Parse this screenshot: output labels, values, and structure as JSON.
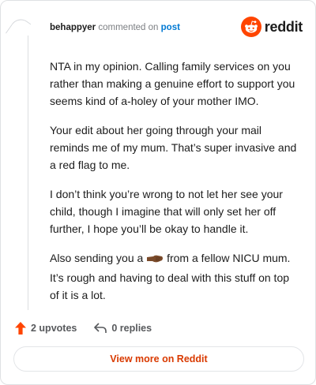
{
  "header": {
    "username": "behappyer",
    "action": "commented on",
    "target": "post"
  },
  "brand": {
    "wordmark": "reddit",
    "icon": "reddit-snoo-icon",
    "color": "#ff4500"
  },
  "comment": {
    "paragraphs": [
      "NTA in my opinion. Calling family services on you rather than making a genuine effort to support you seems kind of a-holey of your mother IMO.",
      "Your edit about her going through your mail reminds me of my mum. That’s super invasive and a red flag to me.",
      "I don’t think you’re wrong to not let her see your child, though I imagine that will only set her off further, I hope you’ll be okay to handle it."
    ],
    "last_paragraph": {
      "before_emoji": "Also sending you a ",
      "emoji": "fist-bump-icon",
      "after_emoji": " from a fellow NICU mum. It’s rough and having to deal with this stuff on top of it is a lot."
    }
  },
  "footer": {
    "upvotes": "2 upvotes",
    "replies": "0 replies",
    "upvote_color": "#ff4500"
  },
  "cta": {
    "label": "View more on Reddit",
    "color": "#d93a00"
  }
}
